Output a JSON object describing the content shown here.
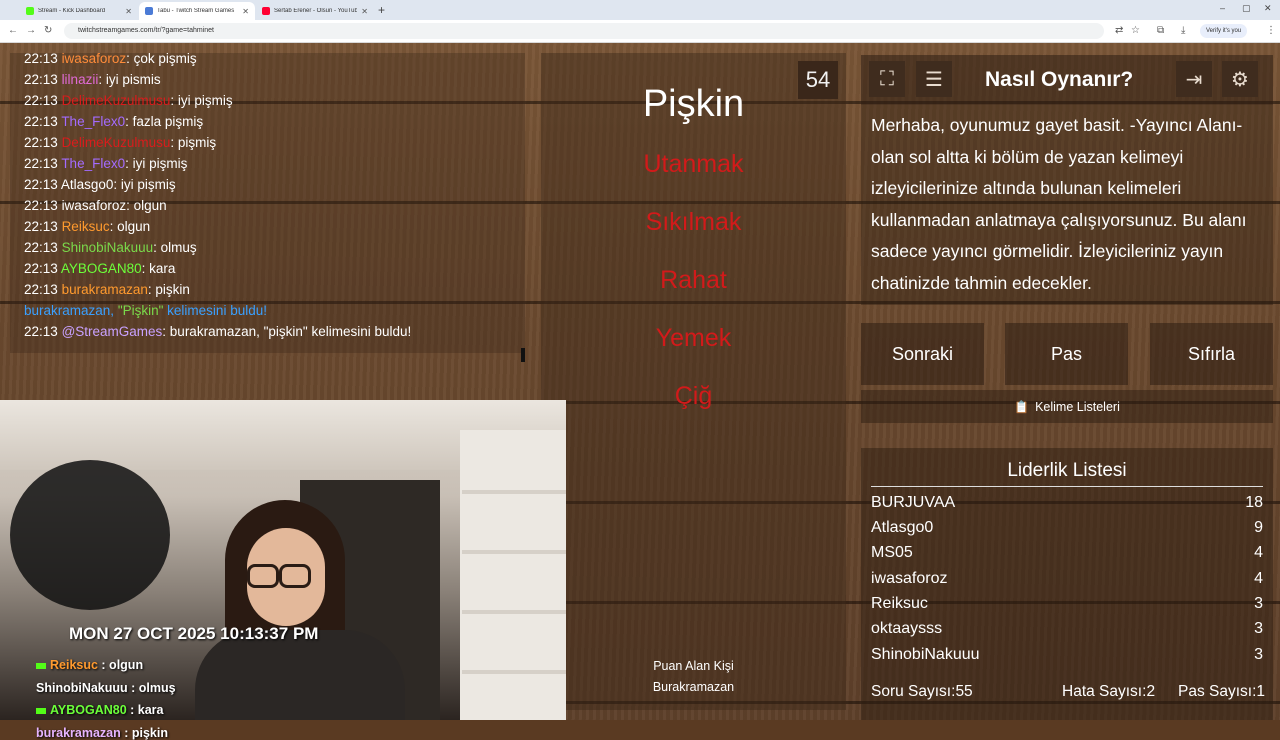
{
  "browser": {
    "tabs": [
      {
        "title": "Stream - Kick Dashboard",
        "color": "#53fc18",
        "active": false
      },
      {
        "title": "Tabu - Twitch Stream Games",
        "color": "#4b7bd6",
        "active": true
      },
      {
        "title": "Sertab Erener - Olsun - YouTube",
        "color": "#ff0033",
        "active": false
      }
    ],
    "new_tab": "+",
    "url": "twitchstreamgames.com/tr/?game=tahminet",
    "verify_label": "Verify it's you"
  },
  "chat": {
    "lines": [
      {
        "time": "22:13",
        "user": "iwasaforoz",
        "user_color": "#ff8c3a",
        "text": ": çok pişmiş"
      },
      {
        "time": "22:13",
        "user": "lilnazii",
        "user_color": "#e06ad6",
        "text": ": iyi pismis"
      },
      {
        "time": "22:13",
        "user": "DelimeKuzulmusu",
        "user_color": "#d91c1c",
        "text": ": iyi pişmiş"
      },
      {
        "time": "22:13",
        "user": "The_Flex0",
        "user_color": "#a36bff",
        "text": ": fazla pişmiş"
      },
      {
        "time": "22:13",
        "user": "DelimeKuzulmusu",
        "user_color": "#d91c1c",
        "text": ": pişmiş"
      },
      {
        "time": "22:13",
        "user": "The_Flex0",
        "user_color": "#a36bff",
        "text": ": iyi pişmiş"
      },
      {
        "time": "22:13",
        "user": "Atlasgo0",
        "user_color": "#ffffff",
        "text": ": iyi pişmiş"
      },
      {
        "time": "22:13",
        "user": "iwasaforoz",
        "user_color": "#ffffff",
        "text": ": olgun"
      },
      {
        "time": "22:13",
        "user": "Reiksuc",
        "user_color": "#ff9a2e",
        "text": ": olgun"
      },
      {
        "time": "22:13",
        "user": "ShinobiNakuuu",
        "user_color": "#7ad94a",
        "text": ": olmuş"
      },
      {
        "time": "22:13",
        "user": "AYBOGAN80",
        "user_color": "#6cff3a",
        "text": ": kara"
      },
      {
        "time": "22:13",
        "user": "burakramazan",
        "user_color": "#ff9a2e",
        "text": ": pişkin"
      }
    ],
    "found_notice": {
      "user": "burakramazan,",
      "word": "\"Pişkin\"",
      "suffix": " kelimesini buldu!"
    },
    "bot_line": {
      "time": "22:13",
      "user": "@StreamGames",
      "text": ": burakramazan, \"pişkin\" kelimesini buldu!"
    }
  },
  "game": {
    "word": "Pişkin",
    "timer": "54",
    "taboo_words": [
      "Utanmak",
      "Sıkılmak",
      "Rahat",
      "Yemek",
      "Çiğ"
    ],
    "scorer_label": "Puan Alan Kişi",
    "scorer_name": "Burakramazan"
  },
  "panel": {
    "title": "Nasıl Oynanır?",
    "description": "Merhaba, oyunumuz gayet basit. -Yayıncı Alanı- olan sol altta ki bölüm de yazan kelimeyi izleyicilerinize altında bulunan kelimeleri kullanmadan anlatmaya çalışıyorsunuz. Bu alanı sadece yayıncı görmelidir. İzleyicileriniz yayın chatinizde tahmin edecekler.",
    "buttons": {
      "next": "Sonraki",
      "pass": "Pas",
      "reset": "Sıfırla"
    },
    "word_lists": "Kelime Listeleri"
  },
  "leaderboard": {
    "title": "Liderlik Listesi",
    "rows": [
      {
        "name": "BURJUVAA",
        "score": "18"
      },
      {
        "name": "Atlasgo0",
        "score": "9"
      },
      {
        "name": "MS05",
        "score": "4"
      },
      {
        "name": "iwasaforoz",
        "score": "4"
      },
      {
        "name": "Reiksuc",
        "score": "3"
      },
      {
        "name": "oktaaysss",
        "score": "3"
      },
      {
        "name": "ShinobiNakuuu",
        "score": "3"
      }
    ],
    "stats": {
      "questions_label": "Soru Sayısı:",
      "questions": "55",
      "errors_label": "Hata Sayısı:",
      "errors": "2",
      "passes_label": "Pas Sayısı:",
      "passes": "1"
    }
  },
  "webcam": {
    "timestamp": "MON 27 OCT 2025 10:13:37 PM",
    "overlay_chat": [
      {
        "user": "Reiksuc",
        "user_color": "#ff9a2e",
        "text": " : olgun",
        "badge": true
      },
      {
        "user": "ShinobiNakuuu",
        "user_color": "#ffffff",
        "text": " : olmuş",
        "badge": false
      },
      {
        "user": "AYBOGAN80",
        "user_color": "#6cff3a",
        "text": " : kara",
        "badge": true
      },
      {
        "user": "burakramazan",
        "user_color": "#e6b4ff",
        "text": " : pişkin",
        "badge": false
      }
    ]
  }
}
